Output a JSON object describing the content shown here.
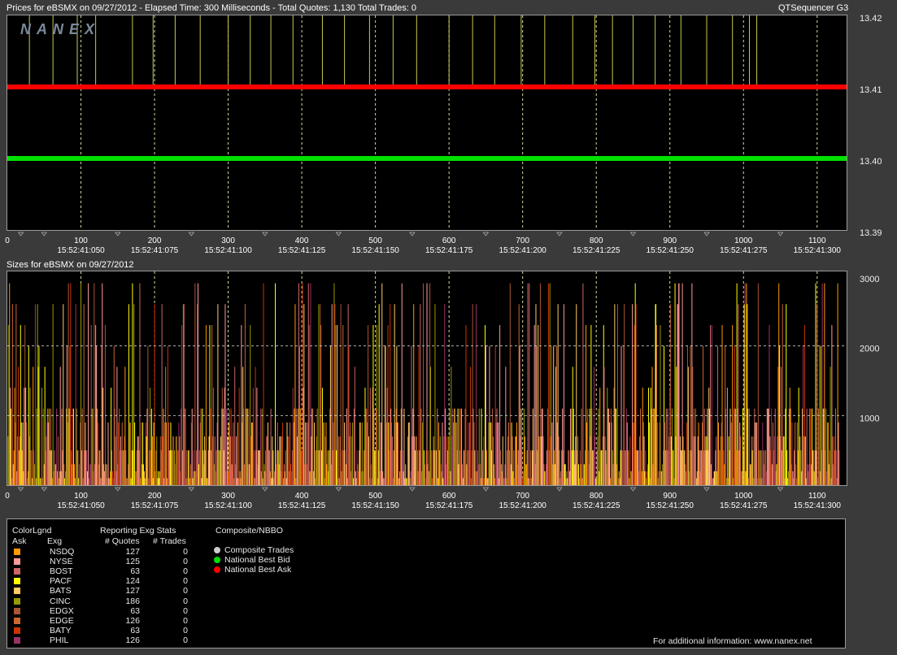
{
  "prices_header": {
    "title": "Prices for  eBSMX  on  09/27/2012  -  Elapsed Time: 300 Milliseconds  -  Total Quotes: 1,130  Total Trades: 0",
    "app": "QTSequencer G3",
    "watermark": "NANEX"
  },
  "sizes_header": {
    "title": "Sizes for  eBSMX  on  09/27/2012"
  },
  "x_axis": {
    "ticks": [
      "0",
      "100",
      "200",
      "300",
      "400",
      "500",
      "600",
      "700",
      "800",
      "900",
      "1000",
      "1100"
    ],
    "times": [
      "15:52:41:050",
      "15:52:41:075",
      "15:52:41:100",
      "15:52:41:125",
      "15:52:41:150",
      "15:52:41:175",
      "15:52:41:200",
      "15:52:41:225",
      "15:52:41:250",
      "15:52:41:275",
      "15:52:41:300"
    ]
  },
  "chart_data": [
    {
      "type": "line",
      "name": "prices",
      "y_ticks": [
        "13.42",
        "13.41",
        "13.40",
        "13.39"
      ],
      "ylim": [
        13.39,
        13.42
      ],
      "xlim": [
        0,
        1140
      ],
      "series": [
        {
          "name": "National Best Ask",
          "color": "#ff0000",
          "y": 13.41
        },
        {
          "name": "National Best Bid",
          "color": "#00e000",
          "y": 13.4
        }
      ],
      "ask_spikes_x": [
        30,
        62,
        95,
        120,
        170,
        198,
        228,
        262,
        300,
        330,
        358,
        388,
        428,
        458,
        492,
        524,
        556,
        600,
        632,
        662,
        698,
        730,
        768,
        798,
        822,
        850,
        880,
        915,
        950,
        985,
        1008,
        1018
      ],
      "spike_color": "#c8c850"
    },
    {
      "type": "bar",
      "name": "sizes",
      "y_ticks": [
        "3000",
        "2000",
        "1000"
      ],
      "ylim": [
        0,
        3000
      ],
      "xlim": [
        0,
        1140
      ],
      "bar_count": 1130,
      "size_levels": [
        100,
        200,
        300,
        500,
        700,
        900,
        1100,
        1400,
        1700,
        2000,
        2300,
        2600,
        2900
      ]
    }
  ],
  "legend": {
    "color_legend_label": "ColorLgnd",
    "ask_label": "Ask",
    "exg_label": "Exg",
    "stats_label": "Reporting Exg Stats",
    "quotes_label": "# Quotes",
    "trades_label": "# Trades",
    "composite_label": "Composite/NBBO",
    "exchanges": [
      {
        "name": "NSDQ",
        "quotes": "127",
        "trades": "0",
        "color": "#ff9900"
      },
      {
        "name": "NYSE",
        "quotes": "125",
        "trades": "0",
        "color": "#ff9a9a"
      },
      {
        "name": "BOST",
        "quotes": "63",
        "trades": "0",
        "color": "#cc6666"
      },
      {
        "name": "PACF",
        "quotes": "124",
        "trades": "0",
        "color": "#ffff00"
      },
      {
        "name": "BATS",
        "quotes": "127",
        "trades": "0",
        "color": "#ffcc66"
      },
      {
        "name": "CINC",
        "quotes": "186",
        "trades": "0",
        "color": "#999900"
      },
      {
        "name": "EDGX",
        "quotes": "63",
        "trades": "0",
        "color": "#aa5533"
      },
      {
        "name": "EDGE",
        "quotes": "126",
        "trades": "0",
        "color": "#cc6633"
      },
      {
        "name": "BATY",
        "quotes": "63",
        "trades": "0",
        "color": "#cc3300"
      },
      {
        "name": "PHIL",
        "quotes": "126",
        "trades": "0",
        "color": "#993366"
      }
    ],
    "composite": [
      {
        "label": "Composite Trades",
        "color": "#cccccc"
      },
      {
        "label": "National Best Bid",
        "color": "#00dd00"
      },
      {
        "label": "National Best Ask",
        "color": "#ff0000"
      }
    ],
    "footer": "For additional information:  www.nanex.net"
  }
}
